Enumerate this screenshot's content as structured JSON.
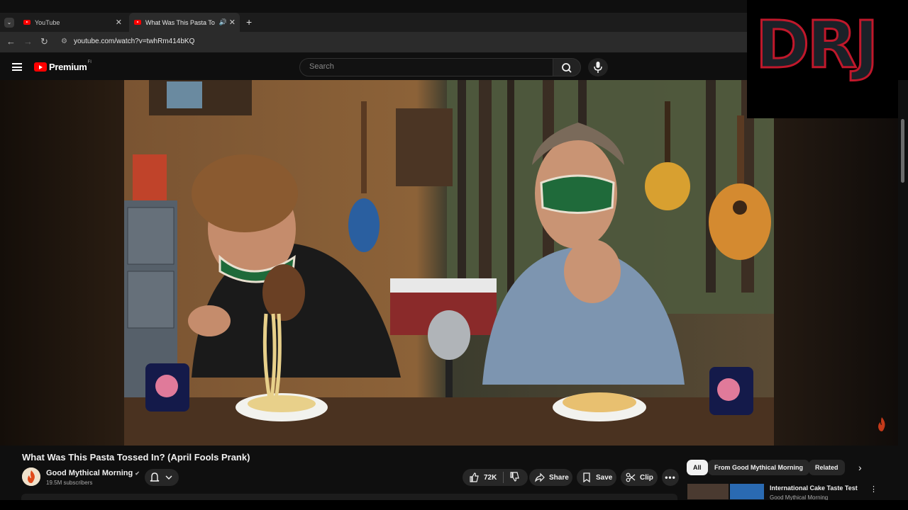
{
  "browser": {
    "tabs": [
      {
        "label": "YouTube"
      },
      {
        "label": "What Was This Pasta Tossed In? (April Fools Prank)"
      }
    ],
    "new_tab": "+",
    "url": "youtube.com/watch?v=twhRm414bKQ"
  },
  "youtube": {
    "logo_text": "Premium",
    "logo_sup": "FI",
    "search_placeholder": "Search"
  },
  "overlay": {
    "watermark_text": "DRJ"
  },
  "video": {
    "title": "What Was This Pasta Tossed In? (April Fools Prank)",
    "channel": "Good Mythical Morning",
    "subscribers": "19.5M subscribers",
    "likes": "72K",
    "share_label": "Share",
    "save_label": "Save",
    "clip_label": "Clip"
  },
  "sidebar": {
    "chips": [
      {
        "label": "All"
      },
      {
        "label": "From Good Mythical Morning"
      },
      {
        "label": "Related"
      }
    ],
    "recommendation": {
      "title": "International Cake Taste Test",
      "channel": "Good Mythical Morning"
    }
  },
  "colors": {
    "accent": "#ff0000",
    "background": "#0f0f0f",
    "watermark_stroke": "#c0182b"
  }
}
